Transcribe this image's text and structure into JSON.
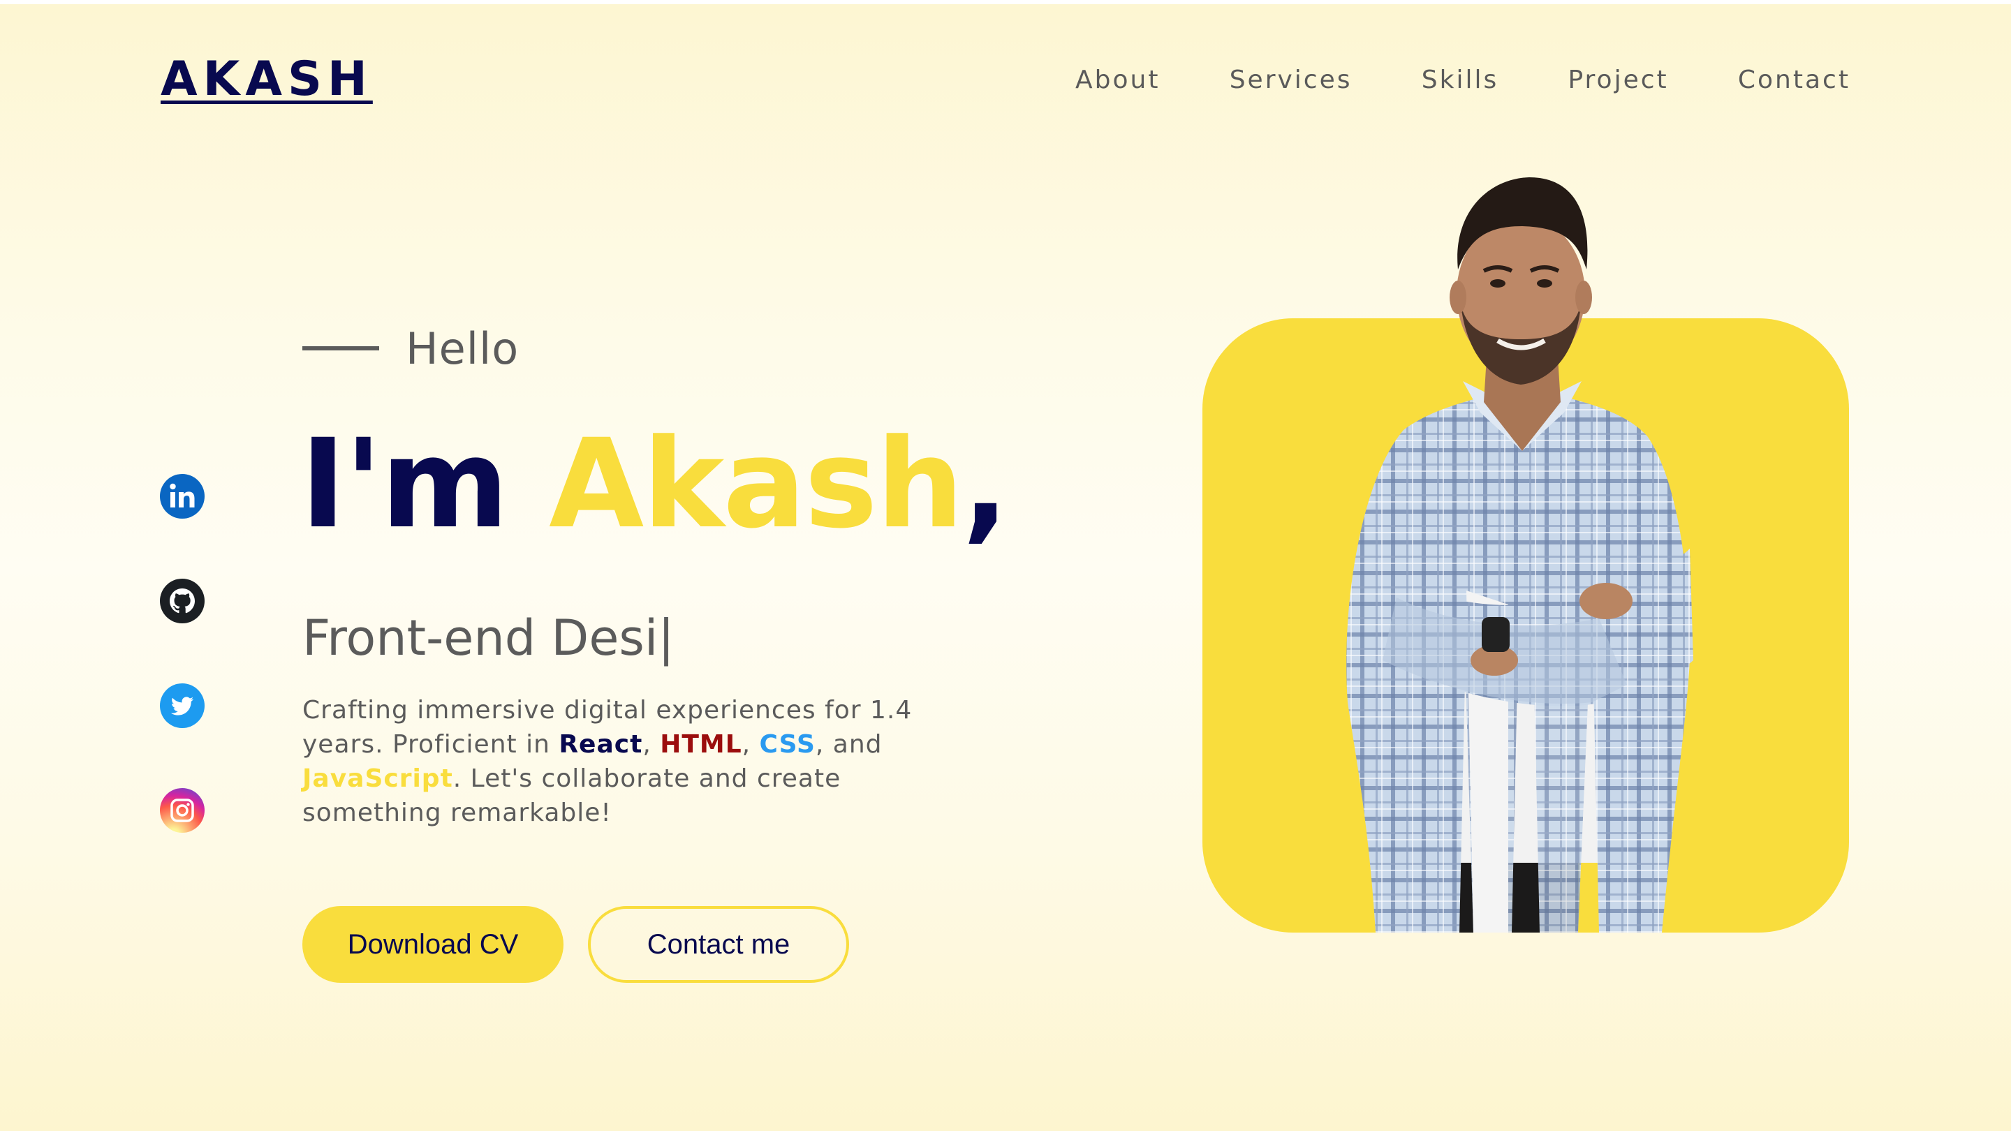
{
  "header": {
    "logo": "AKASH",
    "nav": [
      {
        "label": "About"
      },
      {
        "label": "Services"
      },
      {
        "label": "Skills"
      },
      {
        "label": "Project"
      },
      {
        "label": "Contact"
      }
    ]
  },
  "socials": [
    {
      "icon": "linkedin-icon",
      "color": "#0a66c2"
    },
    {
      "icon": "github-icon",
      "color": "#1b1f23"
    },
    {
      "icon": "twitter-icon",
      "color": "#1d9bf0"
    },
    {
      "icon": "instagram-icon",
      "color": "#e1306c"
    }
  ],
  "hero": {
    "greeting": "Hello",
    "headline_prefix": "I'm",
    "headline_name": "Akash",
    "headline_suffix": ",",
    "role_typed": "Front-end Desi|",
    "bio": {
      "part1": "Crafting immersive digital experiences for 1.4 years. Proficient in ",
      "react": "React",
      "sep1": ", ",
      "html": "HTML",
      "sep2": ", ",
      "css": "CSS",
      "sep3": ", and ",
      "javascript": "JavaScript",
      "part2": ". Let's collaborate and create something remarkable!"
    },
    "buttons": {
      "download": "Download CV",
      "contact": "Contact me"
    }
  },
  "colors": {
    "navy": "#08094f",
    "accent_yellow": "#f9dd3d",
    "text_gray": "#5b5b5b",
    "html_red": "#9b0d0d",
    "css_blue": "#2a9af0"
  }
}
